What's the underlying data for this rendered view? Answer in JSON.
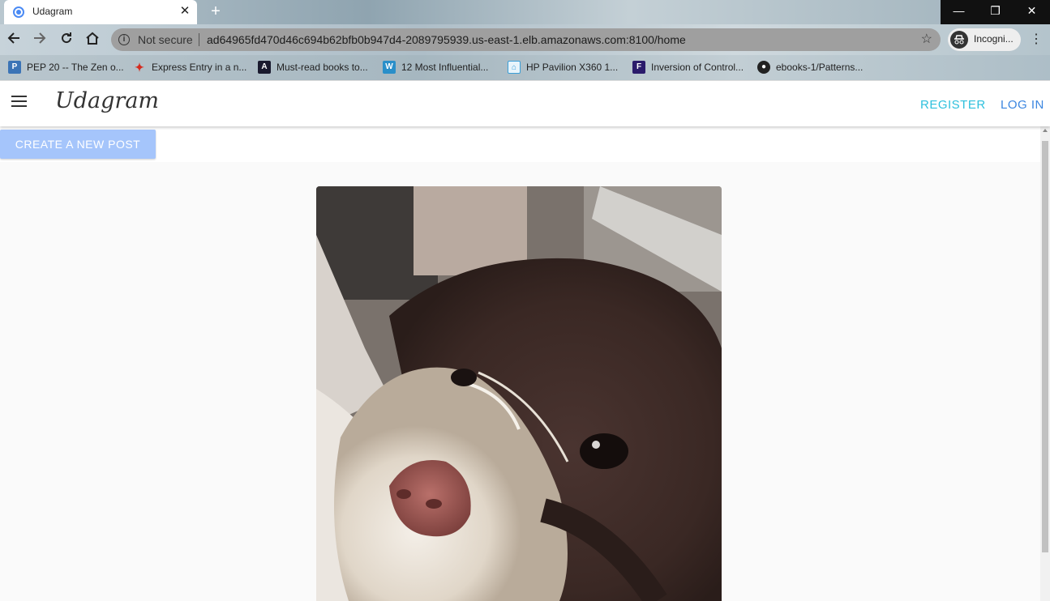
{
  "browser": {
    "tab_title": "Udagram",
    "tab_close": "✕",
    "new_tab": "+",
    "window_buttons": [
      "—",
      "❐",
      "✕"
    ],
    "security_label": "Not secure",
    "url": "ad64965fd470d46c694b62bfb0b947d4-2089795939.us-east-1.elb.amazonaws.com:8100/home",
    "profile_label": "Incogni..."
  },
  "bookmarks": [
    {
      "label": "PEP 20 -- The Zen o...",
      "icon": "python-icon",
      "color": "#3b74b6"
    },
    {
      "label": "Express Entry in a n...",
      "icon": "maple-leaf-icon",
      "color": "#d52b1e"
    },
    {
      "label": "Must-read books to...",
      "icon": "book-icon",
      "color": "#1a1a2e"
    },
    {
      "label": "12 Most Influential...",
      "icon": "wordpress-icon",
      "color": "#2a8fc9"
    },
    {
      "label": "HP Pavilion X360 1...",
      "icon": "house-icon",
      "color": "#3a9fd8"
    },
    {
      "label": "Inversion of Control...",
      "icon": "f-icon",
      "color": "#2b1b6b"
    },
    {
      "label": "ebooks-1/Patterns...",
      "icon": "github-icon",
      "color": "#222222"
    }
  ],
  "app": {
    "brand": "Udagram",
    "register_label": "REGISTER",
    "login_label": "LOG IN",
    "create_post_label": "CREATE A NEW POST"
  },
  "feed": {
    "image_alt": "dog photo"
  }
}
